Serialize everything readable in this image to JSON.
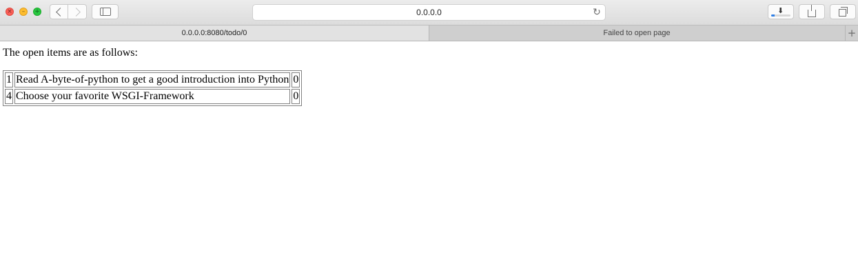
{
  "browser": {
    "address_text": "0.0.0.0",
    "download_progress": 0.18,
    "tabs": [
      {
        "label": "0.0.0.0:8080/todo/0",
        "active": true
      },
      {
        "label": "Failed to open page",
        "active": false
      }
    ]
  },
  "page": {
    "intro": "The open items are as follows:",
    "rows": [
      {
        "id": "1",
        "task": "Read A-byte-of-python to get a good introduction into Python",
        "status": "0"
      },
      {
        "id": "4",
        "task": "Choose your favorite WSGI-Framework",
        "status": "0"
      }
    ]
  },
  "colors": {
    "close": "#fc5f57",
    "minimize": "#fdbc2e",
    "maximize": "#28c840",
    "accent": "#2f7fe6"
  },
  "icons": [
    "close-icon",
    "minimize-icon",
    "maximize-icon",
    "back-icon",
    "forward-icon",
    "sidebar-icon",
    "reload-icon",
    "download-icon",
    "share-icon",
    "tabs-overview-icon",
    "new-tab-icon"
  ]
}
